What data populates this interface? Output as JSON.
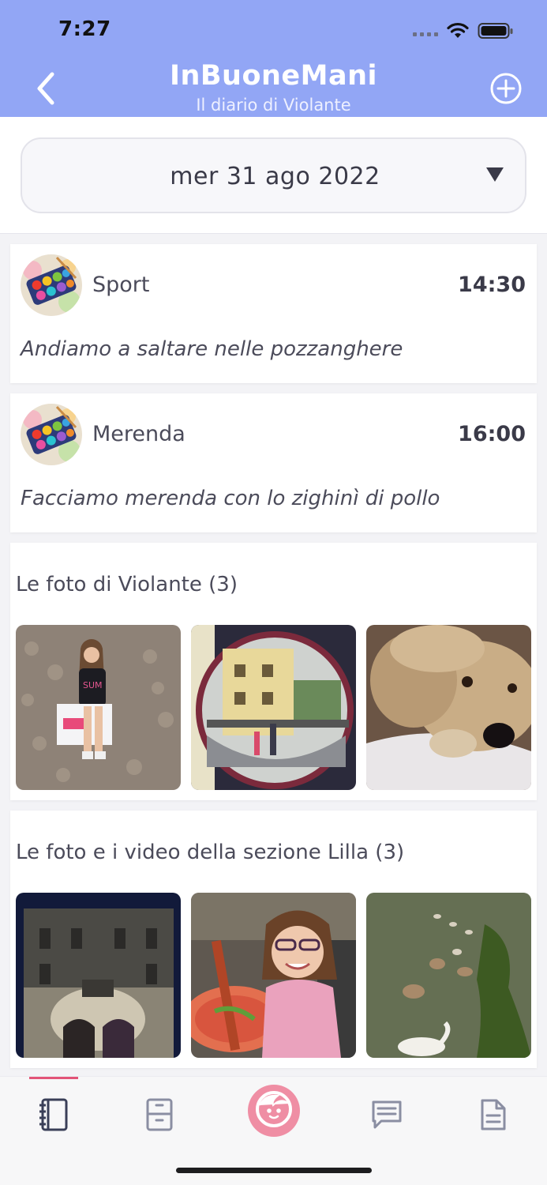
{
  "status_bar": {
    "time": "7:27"
  },
  "header": {
    "title": "InBuoneMani",
    "subtitle": "Il diario di Violante",
    "back_icon": "chevron-left-icon",
    "add_icon": "plus-circle-icon"
  },
  "date_selector": {
    "value": "mer 31 ago  2022",
    "icon": "triangle-down-icon"
  },
  "events": [
    {
      "title": "Sport",
      "time": "14:30",
      "note": "Andiamo a saltare nelle pozzanghere"
    },
    {
      "title": "Merenda",
      "time": "16:00",
      "note": "Facciamo merenda con lo zighinì di pollo"
    }
  ],
  "photo_sections": [
    {
      "title": "Le foto di Violante (3)",
      "count": 3
    },
    {
      "title": "Le foto e i video della sezione Lilla (3)",
      "count": 3
    }
  ],
  "tabbar": {
    "tabs": [
      "diary-icon",
      "locker-icon",
      "child-face-icon",
      "chat-icon",
      "document-icon"
    ],
    "active_index": 0
  },
  "colors": {
    "header": "#92a6f5",
    "accent": "#e25478",
    "center_tab": "#ef8ea4"
  }
}
